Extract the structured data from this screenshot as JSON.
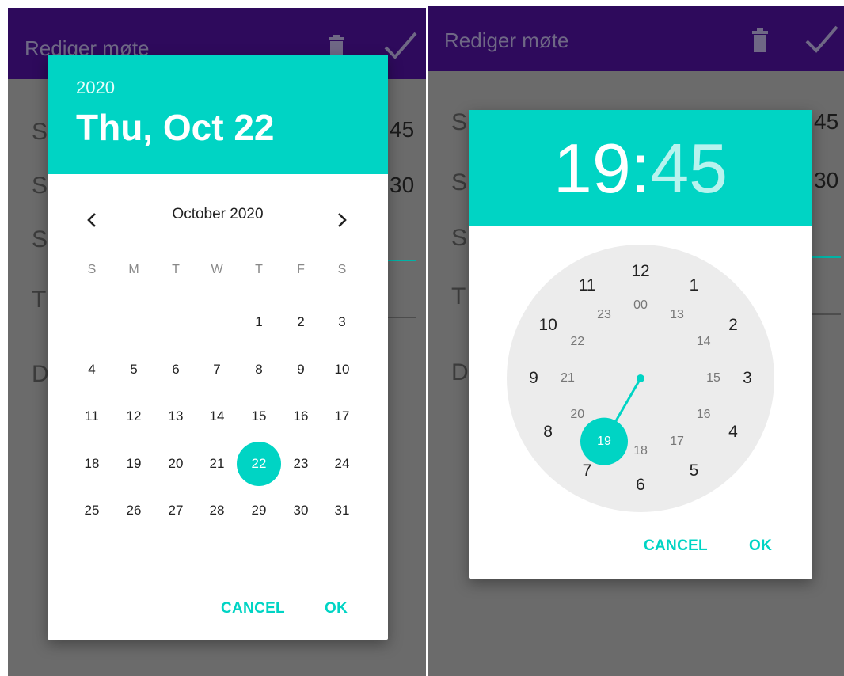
{
  "left": {
    "appbar": {
      "title": "Rediger møte",
      "icons": [
        "trash-icon",
        "check-icon"
      ]
    },
    "background": {
      "row_letters": [
        "S",
        "S",
        "S",
        "T",
        "D"
      ],
      "row_values": [
        "45",
        "30"
      ]
    },
    "date_dialog": {
      "year": "2020",
      "selected_date": "Thu, Oct 22",
      "month_title": "October 2020",
      "weekdays": [
        "S",
        "M",
        "T",
        "W",
        "T",
        "F",
        "S"
      ],
      "weeks": [
        [
          "",
          "",
          "",
          "",
          "1",
          "2",
          "3"
        ],
        [
          "4",
          "5",
          "6",
          "7",
          "8",
          "9",
          "10"
        ],
        [
          "11",
          "12",
          "13",
          "14",
          "15",
          "16",
          "17"
        ],
        [
          "18",
          "19",
          "20",
          "21",
          "22",
          "23",
          "24"
        ],
        [
          "25",
          "26",
          "27",
          "28",
          "29",
          "30",
          "31"
        ]
      ],
      "selected_day": "22",
      "cancel_label": "CANCEL",
      "ok_label": "OK",
      "accent_color": "#00d4c4"
    }
  },
  "right": {
    "appbar": {
      "title": "Rediger møte",
      "icons": [
        "trash-icon",
        "check-icon"
      ]
    },
    "background": {
      "row_letters": [
        "S",
        "S",
        "S",
        "T",
        "D"
      ],
      "row_values": [
        "45",
        "30"
      ]
    },
    "time_dialog": {
      "hour": "19",
      "separator": ":",
      "minute": "45",
      "outer_numbers": [
        "12",
        "1",
        "2",
        "3",
        "4",
        "5",
        "6",
        "7",
        "8",
        "9",
        "10",
        "11"
      ],
      "inner_numbers": [
        "00",
        "13",
        "14",
        "15",
        "16",
        "17",
        "18",
        "19",
        "20",
        "21",
        "22",
        "23"
      ],
      "selected_hour": "19",
      "cancel_label": "CANCEL",
      "ok_label": "OK",
      "accent_color": "#00d4c4"
    }
  },
  "colors": {
    "appbar": "#2e0a5c",
    "scrim": "#6b6b6b",
    "accent": "#00d4c4",
    "clock_face": "#ececec"
  }
}
